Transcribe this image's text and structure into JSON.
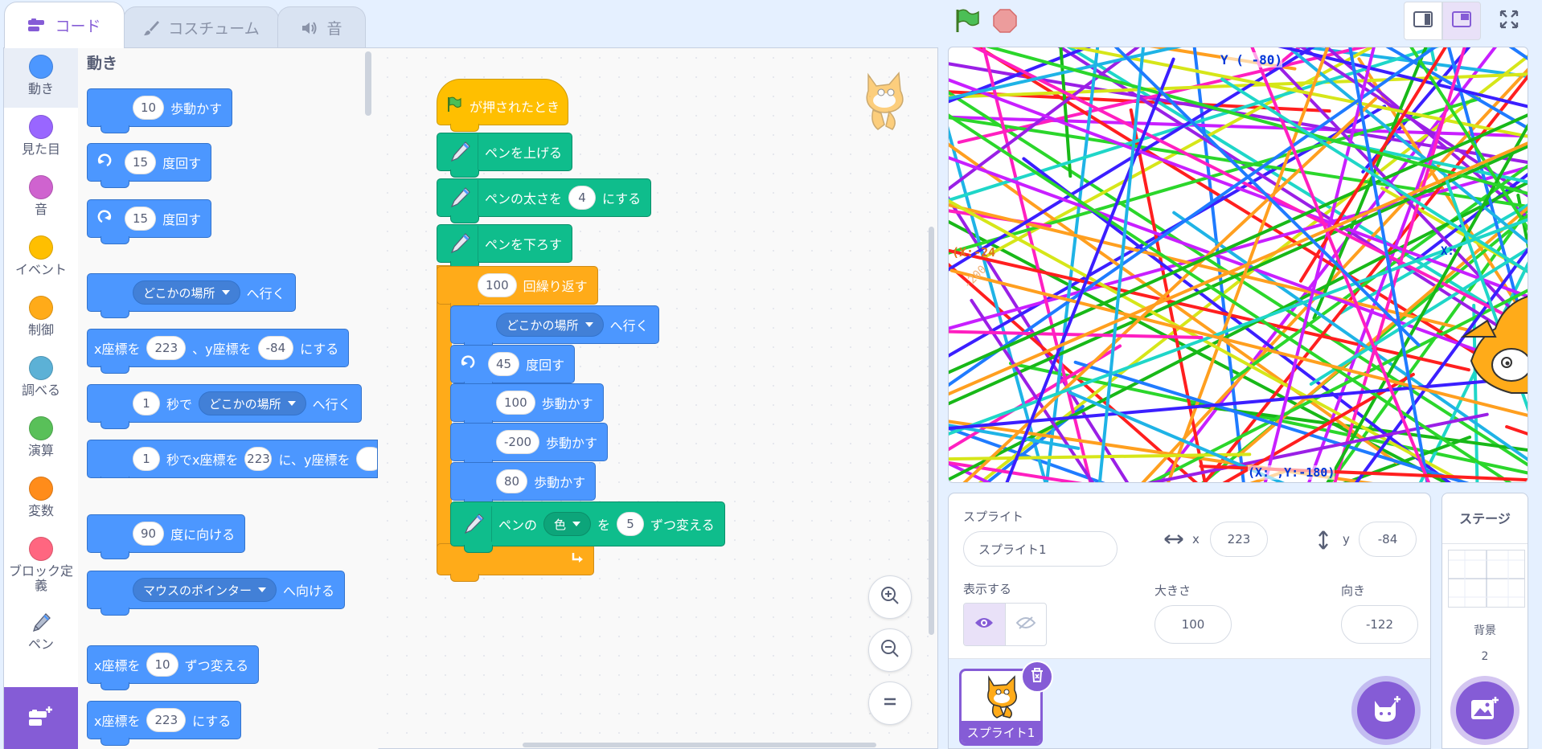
{
  "tabs": [
    {
      "label": "コード",
      "icon": "code-icon",
      "active": true
    },
    {
      "label": "コスチューム",
      "icon": "brush-icon",
      "active": false
    },
    {
      "label": "音",
      "icon": "speaker-icon",
      "active": false
    }
  ],
  "categories": [
    {
      "label": "動き",
      "color": "#4c97ff"
    },
    {
      "label": "見た目",
      "color": "#9966ff"
    },
    {
      "label": "音",
      "color": "#cf63cf"
    },
    {
      "label": "イベント",
      "color": "#ffbf00"
    },
    {
      "label": "制御",
      "color": "#ffab19"
    },
    {
      "label": "調べる",
      "color": "#5cb1d6"
    },
    {
      "label": "演算",
      "color": "#59c059"
    },
    {
      "label": "変数",
      "color": "#ff8c1a"
    },
    {
      "label": "ブロック定義",
      "color": "#ff6680"
    },
    {
      "label": "ペン",
      "icon": "pen-icon"
    }
  ],
  "palette": {
    "title": "動き",
    "move": {
      "value": "10",
      "text": "歩動かす"
    },
    "turn_right": {
      "value": "15",
      "text": "度回す"
    },
    "turn_left": {
      "value": "15",
      "text": "度回す"
    },
    "goto": {
      "dropdown": "どこかの場所",
      "text": "へ行く"
    },
    "goto_xy": {
      "a": "x座標を",
      "x": "223",
      "b": "、y座標を",
      "y": "-84",
      "c": "にする"
    },
    "glide": {
      "secs": "1",
      "a": "秒で",
      "dropdown": "どこかの場所",
      "b": "へ行く"
    },
    "glide_xy": {
      "secs": "1",
      "a": "秒でx座標を",
      "x": "223",
      "b": "に、y座標を"
    },
    "point_dir": {
      "value": "90",
      "text": "度に向ける"
    },
    "point_towards": {
      "dropdown": "マウスのポインター",
      "text": "へ向ける"
    },
    "change_x": {
      "a": "x座標を",
      "value": "10",
      "b": "ずつ変える"
    },
    "set_x": {
      "a": "x座標を",
      "value": "223",
      "b": "にする"
    }
  },
  "script": {
    "hat": "が押されたとき",
    "pen_up": "ペンを上げる",
    "pen_size": {
      "a": "ペンの太さを",
      "value": "4",
      "b": "にする"
    },
    "pen_down": "ペンを下ろす",
    "repeat": {
      "value": "100",
      "text": "回繰り返す"
    },
    "goto": {
      "dropdown": "どこかの場所",
      "text": "へ行く"
    },
    "turn": {
      "value": "45",
      "text": "度回す"
    },
    "move1": {
      "value": "100",
      "text": "歩動かす"
    },
    "move2": {
      "value": "-200",
      "text": "歩動かす"
    },
    "move3": {
      "value": "80",
      "text": "歩動かす"
    },
    "pen_change": {
      "a": "ペンの",
      "dropdown": "色",
      "b": "を",
      "value": "5",
      "c": "ずつ変える"
    }
  },
  "stage": {
    "label_top": "Y (   -80)",
    "label_left": "(X:-24    ",
    "label_left2": "-200",
    "label_bottom": "(X:  ,Y:-180)",
    "label_right": "X:  "
  },
  "sprite_info": {
    "sprite_label": "スプライト",
    "sprite_name": "スプライト1",
    "x_label": "x",
    "x": "223",
    "y_label": "y",
    "y": "-84",
    "show_label": "表示する",
    "size_label": "大きさ",
    "size": "100",
    "direction_label": "向き",
    "direction": "-122"
  },
  "sprites": [
    {
      "name": "スプライト1"
    }
  ],
  "stage_panel": {
    "title": "ステージ",
    "backdrop_label": "背景",
    "backdrop_count": "2"
  },
  "colors": {
    "accent": "#855cd6",
    "motion": "#4c97ff",
    "pen": "#0fbd8c",
    "event": "#ffbf00",
    "control": "#ffab19"
  }
}
